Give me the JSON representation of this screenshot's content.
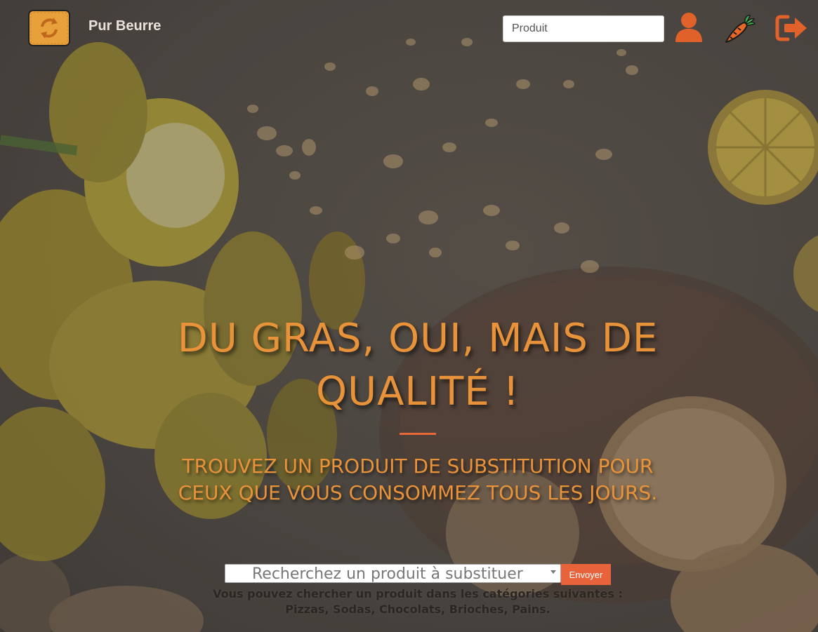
{
  "brand": {
    "name": "Pur Beurre",
    "logo_icon": "refresh-icon"
  },
  "nav": {
    "search_placeholder": "Produit",
    "icons": [
      "user-icon",
      "carrot-icon",
      "sign-out-icon"
    ]
  },
  "hero": {
    "title": "DU GRAS, OUI, MAIS DE QUALITÉ !",
    "subtitle": "TROUVEZ UN PRODUIT DE SUBSTITUTION POUR CEUX QUE VOUS CONSOMMEZ TOUS LES JOURS."
  },
  "search_form": {
    "select_placeholder": "Recherchez un produit à substituer",
    "submit_label": "Envoyer",
    "hint_line1": "Vous pouvez chercher un produit dans les catégories suivantes :",
    "hint_line2": "Pizzas, Sodas, Chocolats, Brioches, Pains."
  },
  "colors": {
    "accent": "#e8923a",
    "button": "#e8633a",
    "icon": "#e0622a"
  }
}
